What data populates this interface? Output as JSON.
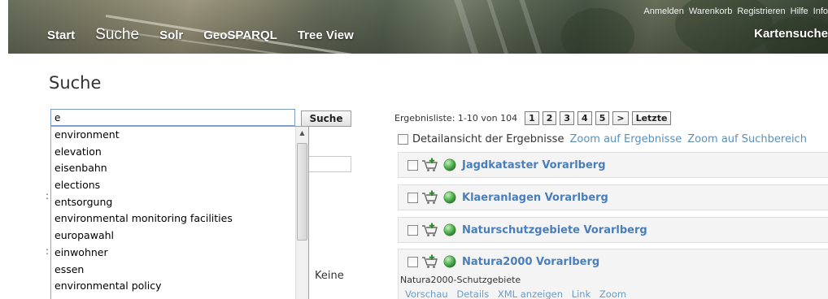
{
  "header": {
    "top_links": [
      "Anmelden",
      "Warenkorb",
      "Registrieren",
      "Hilfe",
      "Info"
    ],
    "nav": [
      {
        "label": "Start",
        "active": false
      },
      {
        "label": "Suche",
        "active": true
      },
      {
        "label": "Solr",
        "active": false
      },
      {
        "label": "GeoSPARQL",
        "active": false
      },
      {
        "label": "Tree View",
        "active": false
      }
    ],
    "right_link": "Kartensuche"
  },
  "page_title": "Suche",
  "search": {
    "value": "e",
    "button_label": "Suche",
    "suggestions": [
      "environment",
      "elevation",
      "eisenbahn",
      "elections",
      "entsorgung",
      "environmental monitoring facilities",
      "europawahl",
      "einwohner",
      "essen",
      "environmental policy"
    ],
    "hidden_option_label": "Keine"
  },
  "results": {
    "summary": "Ergebnisliste: 1-10 von 104",
    "pages": [
      "1",
      "2",
      "3",
      "4",
      "5"
    ],
    "next_label": ">",
    "last_label": "Letzte",
    "detail_label": "Detailansicht der Ergebnisse",
    "zoom_results": "Zoom auf Ergebnisse",
    "zoom_area": "Zoom auf Suchbereich",
    "items": [
      {
        "title": "Jagdkataster Vorarlberg"
      },
      {
        "title": "Klaeranlagen Vorarlberg"
      },
      {
        "title": "Naturschutzgebiete Vorarlberg"
      },
      {
        "title": "Natura2000 Vorarlberg",
        "description": "Natura2000-Schutzgebiete",
        "actions": [
          "Vorschau",
          "Details",
          "XML anzeigen",
          "Link",
          "Zoom"
        ]
      }
    ]
  },
  "colors": {
    "link": "#4a7ebb",
    "link_light": "#6a9cc4",
    "result_bg": "#f4f4f4",
    "globe": "#5cb85c"
  },
  "icons": {
    "cart": "cart-add-icon",
    "layer": "globe-icon",
    "scroll_up": "scroll-up-arrow-icon"
  }
}
